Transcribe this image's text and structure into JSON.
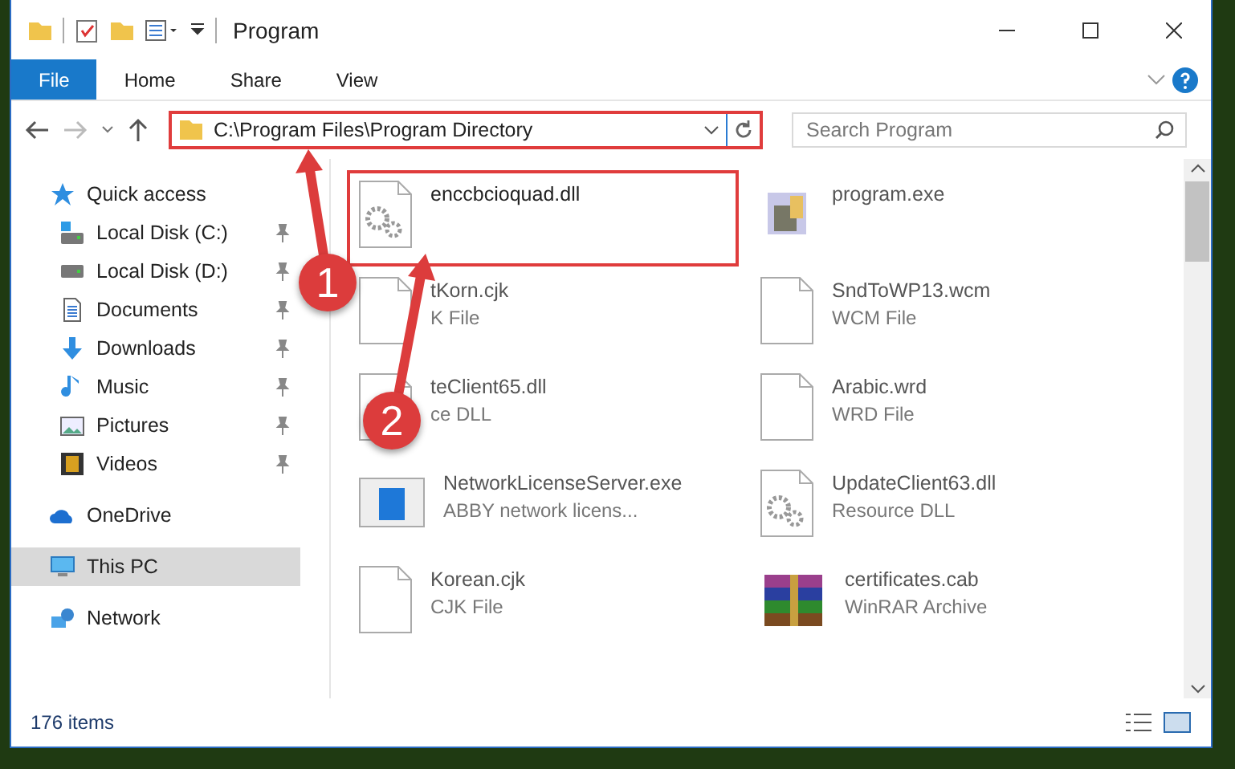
{
  "window": {
    "title": "Program"
  },
  "ribbon_tabs": [
    {
      "label": "File",
      "selected": true
    },
    {
      "label": "Home",
      "selected": false
    },
    {
      "label": "Share",
      "selected": false
    },
    {
      "label": "View",
      "selected": false
    }
  ],
  "address": {
    "path": "C:\\Program Files\\Program Directory",
    "highlighted": true
  },
  "search": {
    "placeholder": "Search Program"
  },
  "sidebar": {
    "items": [
      {
        "label": "Quick access",
        "kind": "star",
        "pinned": false,
        "selected": false,
        "children": [
          {
            "label": "Local Disk (C:)",
            "kind": "disk-c",
            "pinned": true,
            "selected": false
          },
          {
            "label": "Local Disk (D:)",
            "kind": "disk",
            "pinned": true,
            "selected": false
          },
          {
            "label": "Documents",
            "kind": "documents",
            "pinned": true,
            "selected": false
          },
          {
            "label": "Downloads",
            "kind": "downloads",
            "pinned": true,
            "selected": false
          },
          {
            "label": "Music",
            "kind": "music",
            "pinned": true,
            "selected": false
          },
          {
            "label": "Pictures",
            "kind": "pictures",
            "pinned": true,
            "selected": false
          },
          {
            "label": "Videos",
            "kind": "videos",
            "pinned": true,
            "selected": false
          }
        ]
      },
      {
        "label": "OneDrive",
        "kind": "cloud",
        "pinned": false,
        "selected": false
      },
      {
        "label": "This PC",
        "kind": "pc",
        "pinned": false,
        "selected": true
      },
      {
        "label": "Network",
        "kind": "network",
        "pinned": false,
        "selected": false
      }
    ]
  },
  "files": [
    {
      "name": "enccbcioquad.dll",
      "kind": "gear",
      "highlighted": true
    },
    {
      "name": "program.exe",
      "kind": "app"
    },
    {
      "name": "tKorn.cjk",
      "type": "K File",
      "kind": "blank"
    },
    {
      "name": "SndToWP13.wcm",
      "type": "WCM File",
      "kind": "blank"
    },
    {
      "name": "teClient65.dll",
      "type": "ce DLL",
      "kind": "gear"
    },
    {
      "name": "Arabic.wrd",
      "type": "WRD File",
      "kind": "blank"
    },
    {
      "name": "NetworkLicenseServer.exe",
      "type": "ABBY network licens...",
      "kind": "window"
    },
    {
      "name": "UpdateClient63.dll",
      "type": "Resource DLL",
      "kind": "gear"
    },
    {
      "name": "Korean.cjk",
      "type": "CJK File",
      "kind": "blank"
    },
    {
      "name": "certificates.cab",
      "type": "WinRAR Archive",
      "kind": "archive"
    }
  ],
  "annotations": [
    {
      "number": "1"
    },
    {
      "number": "2"
    }
  ],
  "status_bar": {
    "count": "176 items"
  }
}
